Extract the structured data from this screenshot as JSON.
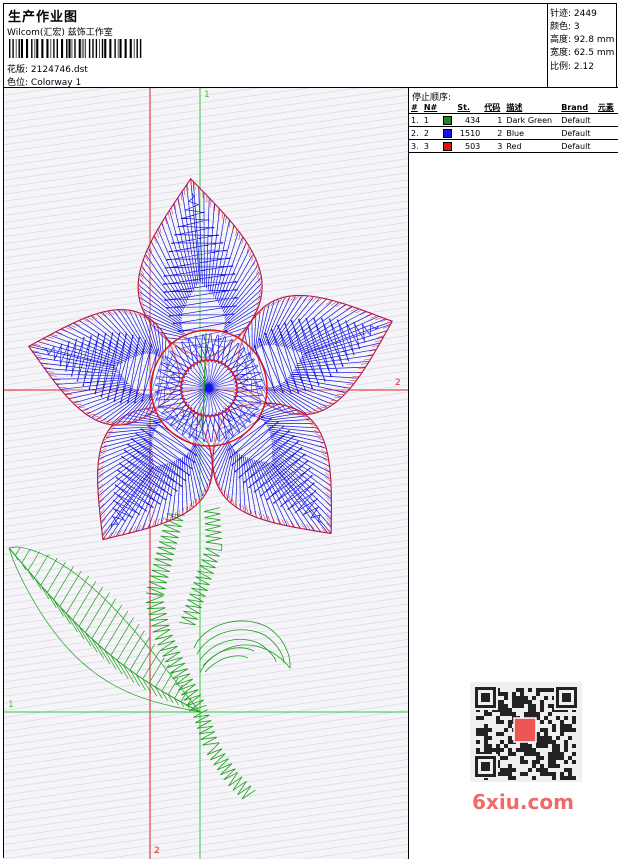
{
  "header": {
    "title": "生产作业图",
    "company": "Wilcom(汇宏) 兹饰工作室",
    "design_label": "花版:",
    "design_value": "2124746.dst",
    "color_label": "色位:",
    "color_value": "Colorway 1"
  },
  "stats": [
    {
      "label": "针迹:",
      "value": "2449"
    },
    {
      "label": "颜色:",
      "value": "3"
    },
    {
      "label": "高度:",
      "value": "92.8 mm"
    },
    {
      "label": "宽度:",
      "value": "62.5 mm"
    },
    {
      "label": "比例:",
      "value": "2.12"
    }
  ],
  "stop_sequence": {
    "title": "停止顺序:",
    "columns": [
      "#",
      "N#",
      "St.",
      "代码",
      "描述",
      "Brand",
      "元素"
    ],
    "rows": [
      {
        "index": "1.",
        "num": "1",
        "color": "#1a8a1a",
        "stitches": "434",
        "code": "1",
        "desc": "Dark Green",
        "brand": "Default"
      },
      {
        "index": "2.",
        "num": "2",
        "color": "#1414e0",
        "stitches": "1510",
        "code": "2",
        "desc": "Blue",
        "brand": "Default"
      },
      {
        "index": "3.",
        "num": "3",
        "color": "#e01414",
        "stitches": "503",
        "code": "3",
        "desc": "Red",
        "brand": "Default"
      }
    ]
  },
  "guides": {
    "h1": "1",
    "h2": "2",
    "v1": "1",
    "v2": "2"
  },
  "watermark": "6xiu.com",
  "colors": {
    "green": "#1aa01a",
    "blue": "#1414e0",
    "red": "#e01414",
    "guide_green": "#33cc33",
    "guide_red": "#e02020"
  }
}
